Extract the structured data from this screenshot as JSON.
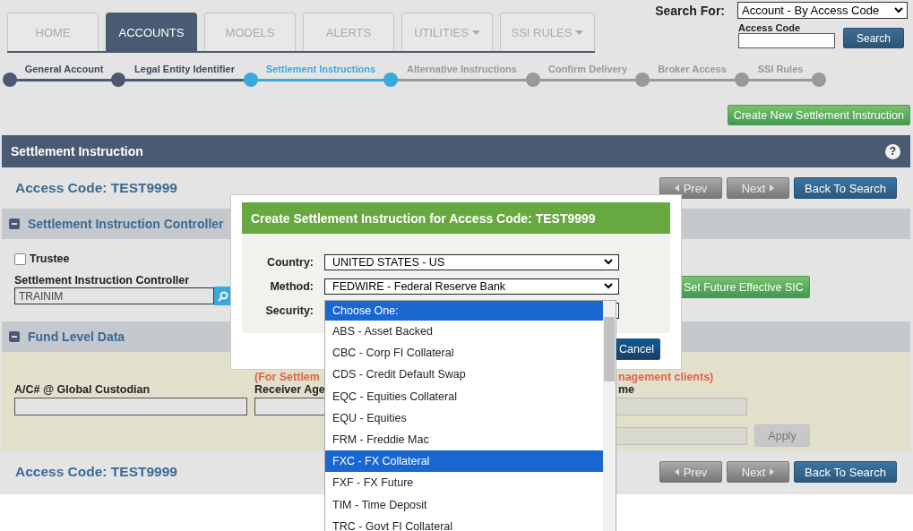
{
  "tabs": [
    {
      "label": "HOME",
      "selected": false,
      "has_menu": false
    },
    {
      "label": "ACCOUNTS",
      "selected": true,
      "has_menu": false
    },
    {
      "label": "MODELS",
      "selected": false,
      "has_menu": false
    },
    {
      "label": "ALERTS",
      "selected": false,
      "has_menu": false
    },
    {
      "label": "UTILITIES",
      "selected": false,
      "has_menu": true
    },
    {
      "label": "SSI RULES",
      "selected": false,
      "has_menu": true
    }
  ],
  "search": {
    "label": "Search For:",
    "value": "Account - By Access Code",
    "code_label": "Access Code",
    "button": "Search"
  },
  "steps": [
    {
      "label": "General Account",
      "completed": true,
      "selected": false
    },
    {
      "label": "Legal Entity Identifier",
      "completed": true,
      "selected": false
    },
    {
      "label": "Settlement Instructions",
      "completed": false,
      "selected": true
    },
    {
      "label": "Alternative Instructions",
      "completed": false,
      "selected": false
    },
    {
      "label": "Confirm Delivery",
      "completed": false,
      "selected": false
    },
    {
      "label": "Broker Access",
      "completed": false,
      "selected": false
    },
    {
      "label": "SSI Rules",
      "completed": false,
      "selected": false
    }
  ],
  "create_button": "Create New Settlement Instruction",
  "panel": {
    "title": "Settlement Instruction",
    "help": "?"
  },
  "access_code_top": "Access Code: TEST9999",
  "nav_top": [
    {
      "kind": "prev",
      "label": "Prev",
      "disabled": true
    },
    {
      "kind": "next",
      "label": "Next",
      "disabled": true
    },
    {
      "kind": "back",
      "label": "Back To Search",
      "disabled": false
    }
  ],
  "sections": [
    {
      "title": "Settlement Instruction Controller",
      "expanded": true
    },
    {
      "title": "Fund Level Data",
      "expanded": true
    }
  ],
  "trustee": {
    "label": "Trustee",
    "checked": false
  },
  "controller": {
    "label": "Settlement Instruction Controller",
    "value": "TRAINIM"
  },
  "future_button": "Set Future Effective SIC",
  "fund": {
    "custodian_label": "A/C# @ Global Custodian",
    "note_left": "(For Settlem",
    "receiver_label": "Receiver Age",
    "note_right": "nagement clients)",
    "name_label": "me",
    "apply": {
      "label": "Apply",
      "disabled": true
    }
  },
  "access_code_bottom": "Access Code: TEST9999",
  "nav_bottom": [
    {
      "kind": "prev",
      "label": "Prev",
      "disabled": true
    },
    {
      "kind": "next",
      "label": "Next",
      "disabled": true
    },
    {
      "kind": "back",
      "label": "Back To Search",
      "disabled": false
    }
  ],
  "dialog": {
    "title": "Create Settlement Instruction for Access Code: TEST9999",
    "fields": [
      {
        "label": "Country:",
        "value": "UNITED STATES - US"
      },
      {
        "label": "Method:",
        "value": "FEDWIRE - Federal Reserve Bank"
      },
      {
        "label": "Security:"
      }
    ],
    "cancel": "Cancel"
  },
  "security_list": {
    "header": "Choose One:",
    "options": [
      {
        "label": "ABS - Asset Backed",
        "selected": false
      },
      {
        "label": "CBC - Corp FI Collateral",
        "selected": false
      },
      {
        "label": "CDS - Credit Default Swap",
        "selected": false
      },
      {
        "label": "EQC - Equities Collateral",
        "selected": false
      },
      {
        "label": "EQU - Equities",
        "selected": false
      },
      {
        "label": "FRM - Freddie Mac",
        "selected": false
      },
      {
        "label": "FXC - FX Collateral",
        "selected": true
      },
      {
        "label": "FXF - FX Future",
        "selected": false
      },
      {
        "label": "TIM - Time Deposit",
        "selected": false
      },
      {
        "label": "TRC - Govt FI Collateral",
        "selected": false
      }
    ]
  }
}
